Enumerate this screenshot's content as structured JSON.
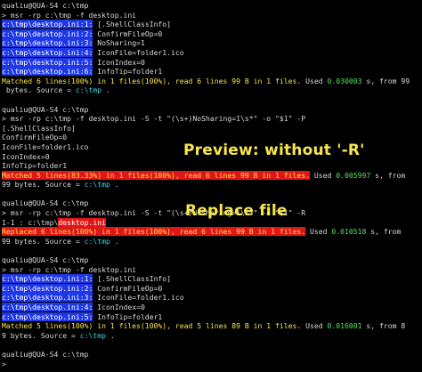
{
  "colors": {
    "background": "#000000",
    "default_text": "#d8d8d8",
    "prompt_yellow": "#f6e64a",
    "number_green": "#55e35a",
    "path_cyan": "#39d6e6",
    "highlight_blue": "#1f38e6",
    "highlight_red": "#e01616"
  },
  "annotations": {
    "preview": "Preview:  without  '-R'",
    "replace": "Replace file"
  },
  "lines": [
    [
      {
        "t": "qualiu@QUA-S4 c:\\tmp",
        "c": "fg-default"
      }
    ],
    [
      {
        "t": "> msr -rp c:\\tmp -f desktop.ini",
        "c": "fg-default"
      }
    ],
    [
      {
        "t": "c:\\tmp\\desktop.ini:1:",
        "c": "bg-blue"
      },
      {
        "t": " [.ShellClassInfo]",
        "c": "fg-default"
      }
    ],
    [
      {
        "t": "c:\\tmp\\desktop.ini:2:",
        "c": "bg-blue"
      },
      {
        "t": " ConfirmFileOp=0",
        "c": "fg-default"
      }
    ],
    [
      {
        "t": "c:\\tmp\\desktop.ini:3:",
        "c": "bg-blue"
      },
      {
        "t": " NoSharing=1",
        "c": "fg-default"
      }
    ],
    [
      {
        "t": "c:\\tmp\\desktop.ini:4:",
        "c": "bg-blue"
      },
      {
        "t": " IconFile=folder1.ico",
        "c": "fg-default"
      }
    ],
    [
      {
        "t": "c:\\tmp\\desktop.ini:5:",
        "c": "bg-blue"
      },
      {
        "t": " IconIndex=0",
        "c": "fg-default"
      }
    ],
    [
      {
        "t": "c:\\tmp\\desktop.ini:6:",
        "c": "bg-blue"
      },
      {
        "t": " InfoTip=folder1",
        "c": "fg-default"
      }
    ],
    [
      {
        "t": "Matched 6 lines(100%) in 1 files(100%), read 6 lines 99 B in 1 files.",
        "c": "fg-yellow"
      },
      {
        "t": " Used ",
        "c": "fg-default"
      },
      {
        "t": "0.030003",
        "c": "fg-green"
      },
      {
        "t": " s, from 99",
        "c": "fg-default"
      }
    ],
    [
      {
        "t": " bytes. Source = ",
        "c": "fg-default"
      },
      {
        "t": "c:\\tmp",
        "c": "fg-cyan"
      },
      {
        "t": " .",
        "c": "fg-default"
      }
    ],
    [
      {
        "t": "",
        "c": "fg-default"
      }
    ],
    [
      {
        "t": "qualiu@QUA-S4 c:\\tmp",
        "c": "fg-default"
      }
    ],
    [
      {
        "t": "> msr -rp c:\\tmp -f desktop.ini -S -t \"(\\s+)NoSharing=1\\s*\" -o \"$1\" -P",
        "c": "fg-default"
      }
    ],
    [
      {
        "t": "[.ShellClassInfo]",
        "c": "fg-default"
      }
    ],
    [
      {
        "t": "ConfirmFileOp=0",
        "c": "fg-default"
      }
    ],
    [
      {
        "t": "IconFile=folder1.ico",
        "c": "fg-default"
      }
    ],
    [
      {
        "t": "IconIndex=0",
        "c": "fg-default"
      }
    ],
    [
      {
        "t": "InfoTip=folder1",
        "c": "fg-default"
      }
    ],
    [
      {
        "t": "Matched 5 lines(83.33%) in 1 files(100%), read 6 lines 99 B in 1 files.",
        "c": "bg-red"
      },
      {
        "t": " Used ",
        "c": "fg-default"
      },
      {
        "t": "0.005997",
        "c": "fg-green"
      },
      {
        "t": " s, from",
        "c": "fg-default"
      }
    ],
    [
      {
        "t": "99 bytes. Source = ",
        "c": "fg-default"
      },
      {
        "t": "c:\\tmp",
        "c": "fg-cyan"
      },
      {
        "t": " .",
        "c": "fg-default"
      }
    ],
    [
      {
        "t": "",
        "c": "fg-default"
      }
    ],
    [
      {
        "t": "qualiu@QUA-S4 c:\\tmp",
        "c": "fg-default"
      }
    ],
    [
      {
        "t": "> msr -rp c:\\tmp -f desktop.ini -S -t \"(\\s+)NoSharing=1\\s*\" -o \"$1\" -R",
        "c": "fg-default"
      }
    ],
    [
      {
        "t": "1-1 : ",
        "c": "fg-default"
      },
      {
        "t": "c:\\tmp\\",
        "c": "fg-default"
      },
      {
        "t": "desktop.ini",
        "c": "bg-red-wt"
      }
    ],
    [
      {
        "t": "Replaced 6 lines(100%) in 1 files(100%), read 6 lines 99 B in 1 files.",
        "c": "bg-red"
      },
      {
        "t": " Used ",
        "c": "fg-default"
      },
      {
        "t": "0.010518",
        "c": "fg-green"
      },
      {
        "t": " s, from",
        "c": "fg-default"
      }
    ],
    [
      {
        "t": "99 bytes. Source = ",
        "c": "fg-default"
      },
      {
        "t": "c:\\tmp",
        "c": "fg-cyan"
      },
      {
        "t": " .",
        "c": "fg-default"
      }
    ],
    [
      {
        "t": "",
        "c": "fg-default"
      }
    ],
    [
      {
        "t": "qualiu@QUA-S4 c:\\tmp",
        "c": "fg-default"
      }
    ],
    [
      {
        "t": "> msr -rp c:\\tmp -f desktop.ini",
        "c": "fg-default"
      }
    ],
    [
      {
        "t": "c:\\tmp\\desktop.ini:1:",
        "c": "bg-blue"
      },
      {
        "t": " [.ShellClassInfo]",
        "c": "fg-default"
      }
    ],
    [
      {
        "t": "c:\\tmp\\desktop.ini:2:",
        "c": "bg-blue"
      },
      {
        "t": " ConfirmFileOp=0",
        "c": "fg-default"
      }
    ],
    [
      {
        "t": "c:\\tmp\\desktop.ini:3:",
        "c": "bg-blue"
      },
      {
        "t": " IconFile=folder1.ico",
        "c": "fg-default"
      }
    ],
    [
      {
        "t": "c:\\tmp\\desktop.ini:4:",
        "c": "bg-blue"
      },
      {
        "t": " IconIndex=0",
        "c": "fg-default"
      }
    ],
    [
      {
        "t": "c:\\tmp\\desktop.ini:5:",
        "c": "bg-blue"
      },
      {
        "t": " InfoTip=folder1",
        "c": "fg-default"
      }
    ],
    [
      {
        "t": "Matched 5 lines(100%) in 1 files(100%), read 5 lines 89 B in 1 files.",
        "c": "fg-yellow"
      },
      {
        "t": " Used ",
        "c": "fg-default"
      },
      {
        "t": "0.016001",
        "c": "fg-green"
      },
      {
        "t": " s, from 8",
        "c": "fg-default"
      }
    ],
    [
      {
        "t": "9 bytes. Source = ",
        "c": "fg-default"
      },
      {
        "t": "c:\\tmp",
        "c": "fg-cyan"
      },
      {
        "t": " .",
        "c": "fg-default"
      }
    ],
    [
      {
        "t": "",
        "c": "fg-default"
      }
    ],
    [
      {
        "t": "qualiu@QUA-S4 c:\\tmp",
        "c": "fg-default"
      }
    ],
    [
      {
        "t": "> ",
        "c": "fg-default"
      }
    ]
  ]
}
